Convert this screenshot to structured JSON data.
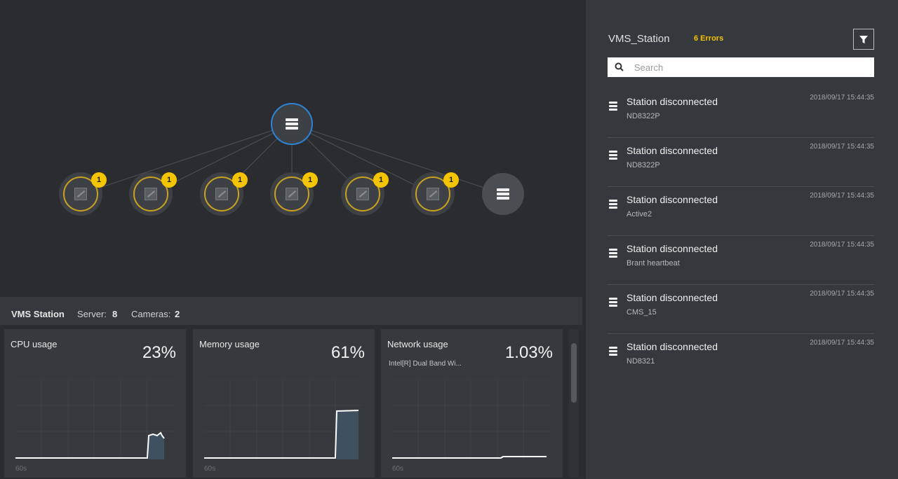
{
  "topology": {
    "root": {
      "icon": "server-icon"
    },
    "children": [
      {
        "badge": "1",
        "icon": "camera-offline-icon"
      },
      {
        "badge": "1",
        "icon": "camera-offline-icon"
      },
      {
        "badge": "1",
        "icon": "camera-offline-icon"
      },
      {
        "badge": "1",
        "icon": "camera-offline-icon"
      },
      {
        "badge": "1",
        "icon": "camera-offline-icon"
      },
      {
        "badge": "1",
        "icon": "camera-offline-icon"
      },
      {
        "badge": "",
        "icon": "server-icon"
      }
    ]
  },
  "info_bar": {
    "station_name": "VMS Station",
    "server_label": "Server:",
    "server_count": "8",
    "cameras_label": "Cameras:",
    "cameras_count": "2"
  },
  "metrics": [
    {
      "title": "CPU usage",
      "subtitle": "",
      "value": "23%",
      "axis_label": "60s"
    },
    {
      "title": "Memory usage",
      "subtitle": "",
      "value": "61%",
      "axis_label": "60s"
    },
    {
      "title": "Network usage",
      "subtitle": "Intel[R] Dual Band Wi...",
      "value": "1.03%",
      "axis_label": "60s"
    }
  ],
  "panel": {
    "title": "VMS_Station",
    "errors": "6 Errors",
    "search_placeholder": "Search",
    "events": [
      {
        "title": "Station disconnected",
        "source": "ND8322P",
        "time": "2018/09/17 15:44:35"
      },
      {
        "title": "Station disconnected",
        "source": "ND8322P",
        "time": "2018/09/17 15:44:35"
      },
      {
        "title": "Station disconnected",
        "source": "Active2",
        "time": "2018/09/17 15:44:35"
      },
      {
        "title": "Station disconnected",
        "source": "Brant heartbeat",
        "time": "2018/09/17 15:44:35"
      },
      {
        "title": "Station disconnected",
        "source": "CMS_15",
        "time": "2018/09/17 15:44:35"
      },
      {
        "title": "Station disconnected",
        "source": "ND8321",
        "time": "2018/09/17 15:44:35"
      }
    ]
  },
  "colors": {
    "accent_blue": "#2e83d4",
    "warning": "#f5c400",
    "panel_bg": "#35383c",
    "canvas_bg": "#2a2c2f"
  }
}
